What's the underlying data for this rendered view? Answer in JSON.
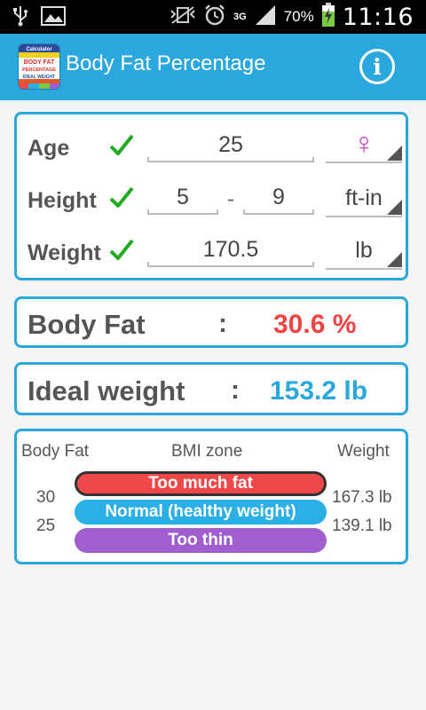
{
  "status_bar": {
    "battery_percent": "70%",
    "network": "3G",
    "time": "11:16",
    "icons": [
      "usb-icon",
      "image-icon",
      "vibrate-mute-icon",
      "alarm-icon",
      "signal-icon",
      "battery-charging-icon"
    ]
  },
  "app_bar": {
    "title": "Body Fat Percentage",
    "info_label": "i",
    "icon_lines": [
      "Calculator",
      "BODY FAT",
      "PERCENTAGE",
      "IDEAL WEIGHT"
    ]
  },
  "inputs": {
    "age": {
      "label": "Age",
      "value": "25",
      "gender_symbol": "♀"
    },
    "height": {
      "label": "Height",
      "feet": "5",
      "separator": "-",
      "inches": "9",
      "unit": "ft-in"
    },
    "weight": {
      "label": "Weight",
      "value": "170.5",
      "unit": "lb"
    }
  },
  "results": {
    "body_fat": {
      "label": "Body Fat",
      "colon": ":",
      "value": "30.6 %"
    },
    "ideal_weight": {
      "label": "Ideal weight",
      "colon": ":",
      "value": "153.2 lb"
    }
  },
  "zone_table": {
    "headers": {
      "body_fat": "Body Fat",
      "zone": "BMI zone",
      "weight": "Weight"
    },
    "thresholds": [
      "30",
      "25"
    ],
    "weights": [
      "167.3 lb",
      "139.1 lb"
    ],
    "zones": [
      {
        "label": "Too much fat",
        "color": "#f04848",
        "selected": true
      },
      {
        "label": "Normal (healthy weight)",
        "color": "#2ab0e4",
        "selected": false
      },
      {
        "label": "Too thin",
        "color": "#a05ecf",
        "selected": false
      }
    ]
  },
  "colors": {
    "accent": "#2aa7dc",
    "body_fat_value": "#f04444",
    "check": "#22aa22",
    "gender": "#cc44cc"
  }
}
